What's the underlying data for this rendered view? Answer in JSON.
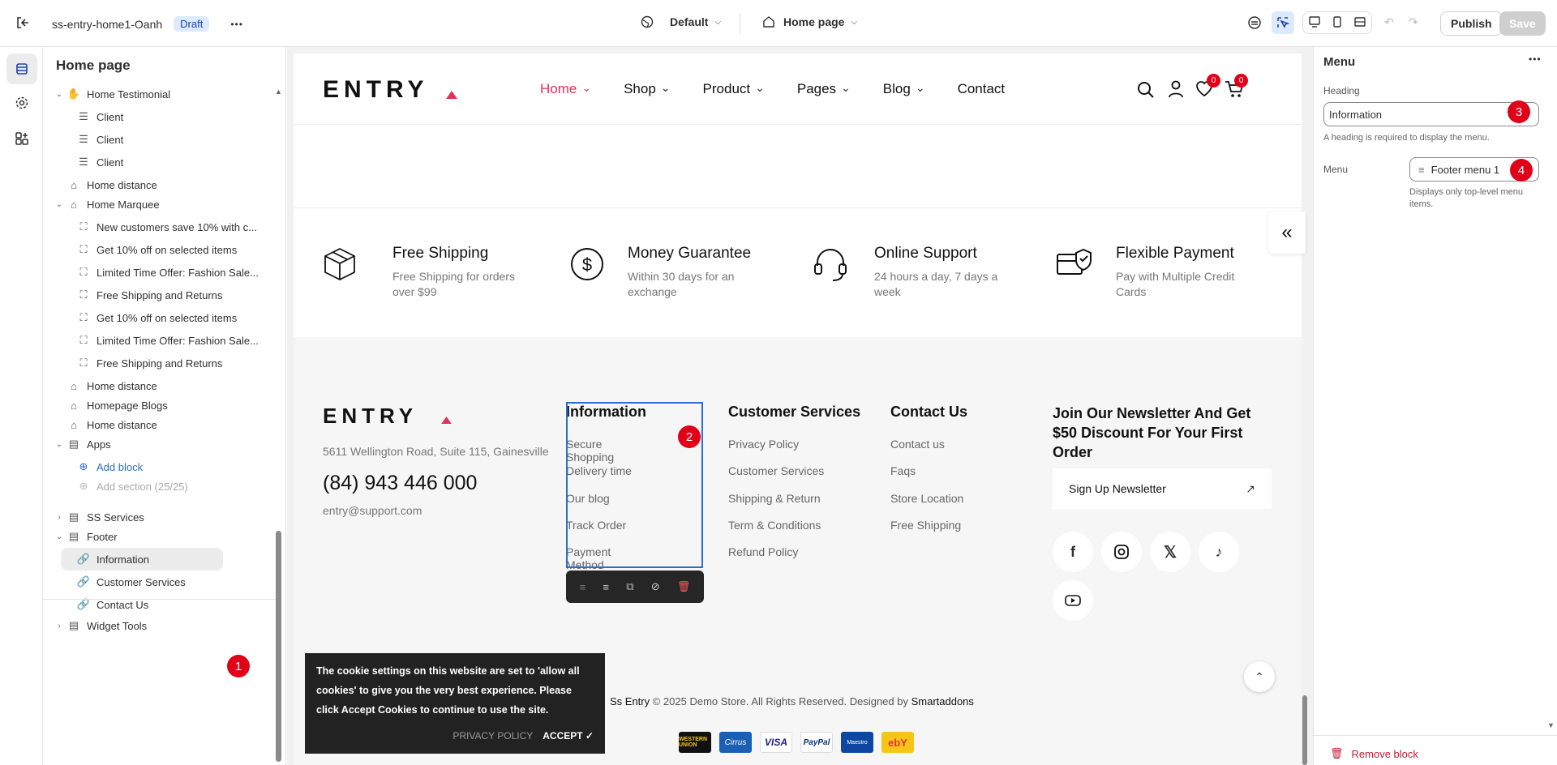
{
  "topbar": {
    "theme_name": "ss-entry-home1-Oanh",
    "status": "Draft",
    "more": "•••",
    "preset": "Default",
    "page": "Home page",
    "publish": "Publish",
    "save": "Save"
  },
  "left": {
    "title": "Home page",
    "items": [
      {
        "label": "Home Testimonial",
        "type": "section",
        "expanded": true
      },
      {
        "label": "Client",
        "type": "block"
      },
      {
        "label": "Client",
        "type": "block"
      },
      {
        "label": "Client",
        "type": "block"
      },
      {
        "label": "Home distance",
        "type": "section"
      },
      {
        "label": "Home Marquee",
        "type": "section",
        "expanded": true
      },
      {
        "label": "New customers save 10% with c...",
        "type": "block"
      },
      {
        "label": "Get 10% off on selected items",
        "type": "block"
      },
      {
        "label": "Limited Time Offer: Fashion Sale...",
        "type": "block"
      },
      {
        "label": "Free Shipping and Returns",
        "type": "block"
      },
      {
        "label": "Get 10% off on selected items",
        "type": "block"
      },
      {
        "label": "Limited Time Offer: Fashion Sale...",
        "type": "block"
      },
      {
        "label": "Free Shipping and Returns",
        "type": "block"
      },
      {
        "label": "Home distance",
        "type": "section"
      },
      {
        "label": "Homepage Blogs",
        "type": "section"
      },
      {
        "label": "Home distance",
        "type": "section"
      },
      {
        "label": "Apps",
        "type": "group",
        "expanded": true
      },
      {
        "label": "Add block",
        "type": "add"
      },
      {
        "label": "Add section (25/25)",
        "type": "disabled"
      },
      {
        "label": "SS Services",
        "type": "group"
      },
      {
        "label": "Footer",
        "type": "group",
        "expanded": true
      },
      {
        "label": "Information",
        "type": "link",
        "selected": true
      },
      {
        "label": "Customer Services",
        "type": "link"
      },
      {
        "label": "Contact Us",
        "type": "link"
      },
      {
        "label": "Widget Tools",
        "type": "group"
      }
    ]
  },
  "markers": [
    "1",
    "2",
    "3",
    "4"
  ],
  "store": {
    "logo": "ENTRY",
    "nav": [
      "Home",
      "Shop",
      "Product",
      "Pages",
      "Blog",
      "Contact"
    ],
    "wishlist_count": "0",
    "cart_count": "0",
    "features": [
      {
        "title": "Free Shipping",
        "desc": "Free Shipping for orders over $99"
      },
      {
        "title": "Money Guarantee",
        "desc": "Within 30 days for an exchange"
      },
      {
        "title": "Online Support",
        "desc": "24 hours a day, 7 days a week"
      },
      {
        "title": "Flexible Payment",
        "desc": "Pay with Multiple Credit Cards"
      }
    ],
    "address": "5611 Wellington Road, Suite 115, Gainesville",
    "phone": "(84) 943 446 000",
    "email": "entry@support.com",
    "info": {
      "title": "Information",
      "links": [
        "Secure Shopping",
        "Delivery time",
        "Our blog",
        "Track Order",
        "Payment Method"
      ]
    },
    "services": {
      "title": "Customer Services",
      "links": [
        "Privacy Policy",
        "Customer Services",
        "Shipping & Return",
        "Term & Conditions",
        "Refund Policy"
      ]
    },
    "contact": {
      "title": "Contact Us",
      "links": [
        "Contact us",
        "Faqs",
        "Store Location",
        "Free Shipping"
      ]
    },
    "newsletter": {
      "title": "Join Our Newsletter And Get $50 Discount For Your First Order",
      "button": "Sign Up Newsletter"
    },
    "copyright_prefix": "Ss Entry",
    "copyright_mid": " © 2025 Demo Store. All Rights Reserved. Designed by ",
    "copyright_brand": "Smartaddons",
    "payments": [
      "WESTERN UNION",
      "Cirrus",
      "VISA",
      "PayPal",
      "Maestro",
      "ebY"
    ],
    "cookie": {
      "text": "The cookie settings on this website are set to 'allow all cookies' to give you the very best experience. Please click Accept Cookies to continue to use the site.",
      "privacy": "PRIVACY POLICY",
      "accept": "ACCEPT ✓"
    }
  },
  "right": {
    "title": "Menu",
    "heading_label": "Heading",
    "heading_value": "Information",
    "heading_help": "A heading is required to display the menu.",
    "menu_label": "Menu",
    "menu_value": "Footer menu 1",
    "menu_help": "Displays only top-level menu items.",
    "remove": "Remove block"
  },
  "colors": {
    "accent": "#e0315b",
    "marker": "#e00018",
    "select": "#2c6ecb"
  }
}
